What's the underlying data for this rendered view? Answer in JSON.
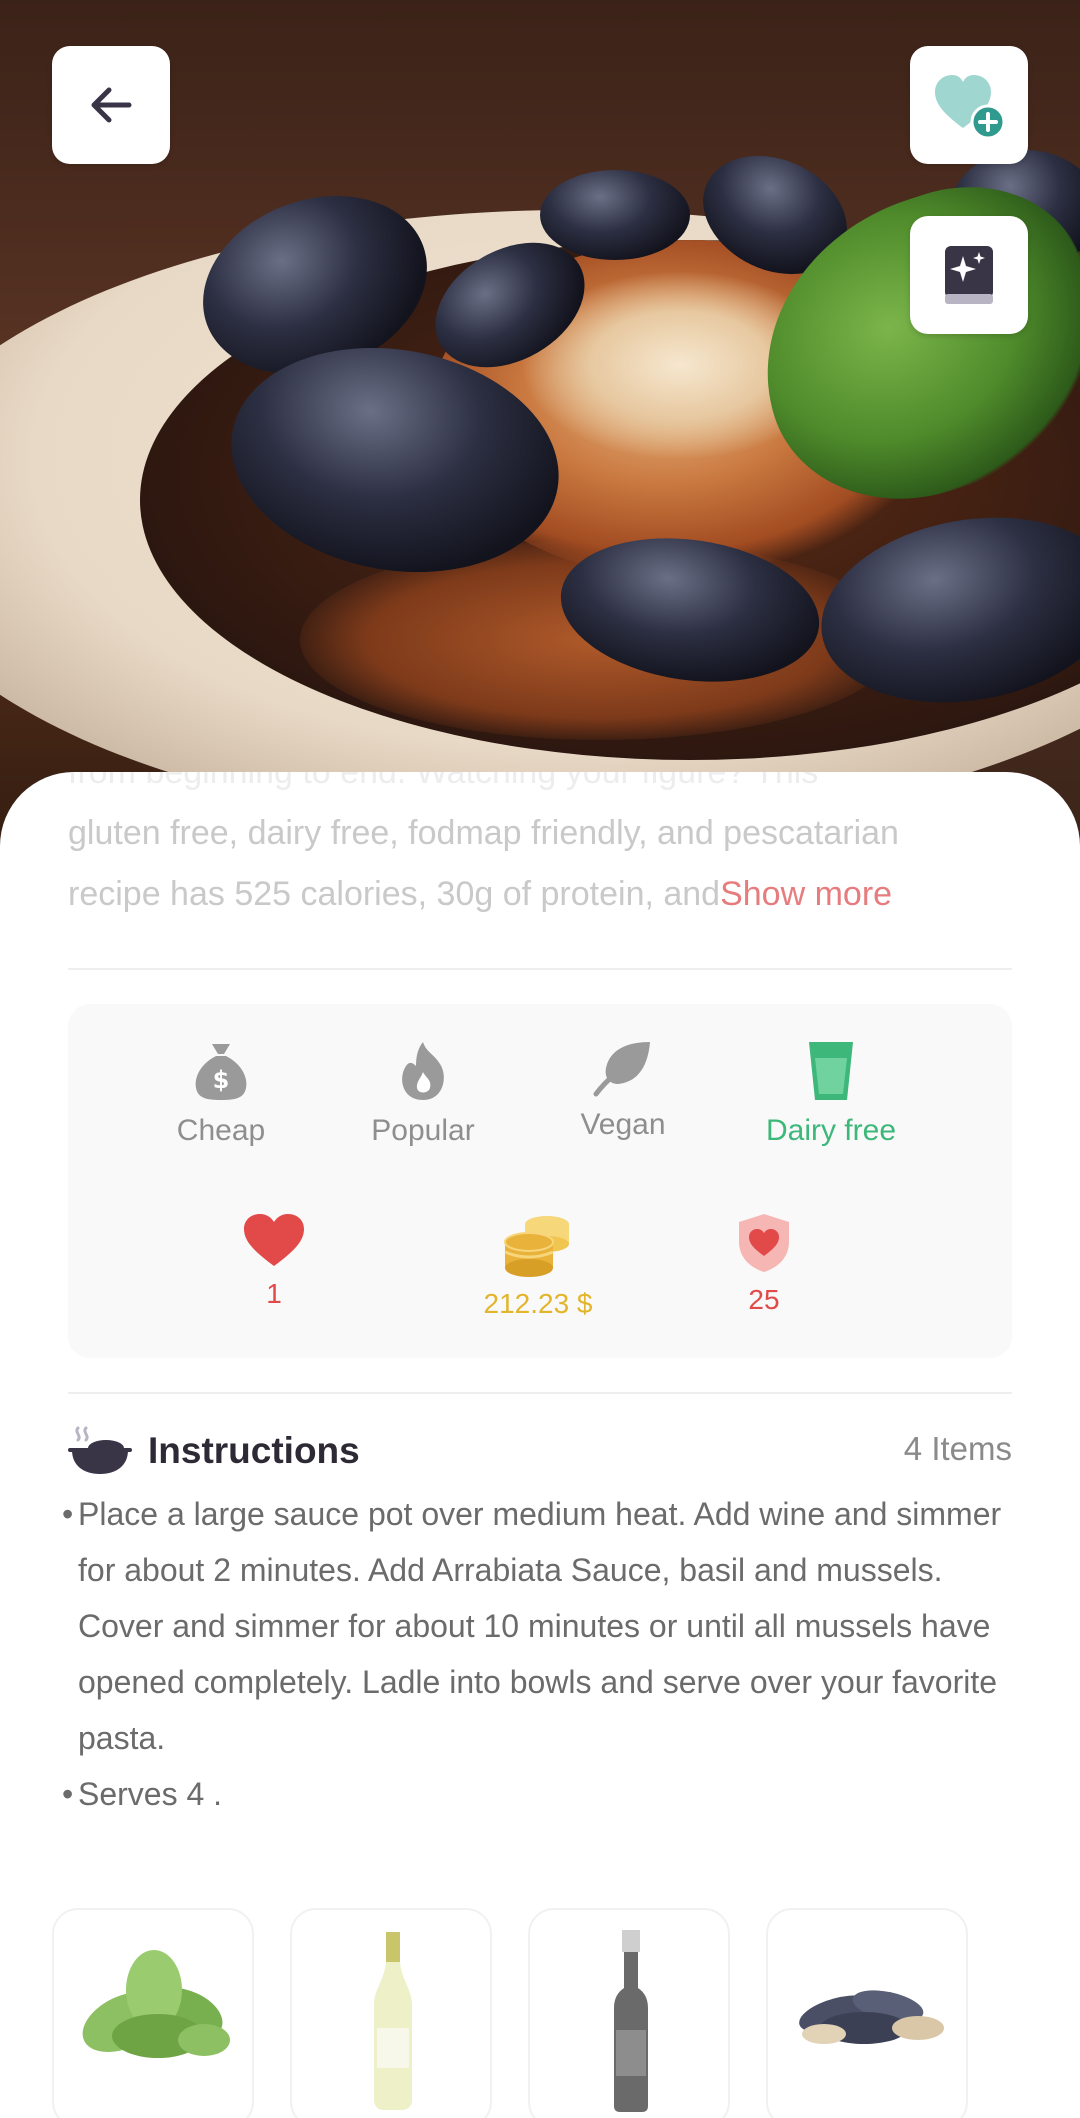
{
  "header": {
    "back_icon": "arrow-left-icon",
    "favorite_icon": "heart-plus-icon",
    "recipe_book_icon": "sparkle-book-icon"
  },
  "summary": {
    "line1": "from beginning to end. Watching your figure? This",
    "line2": "gluten free, dairy free, fodmap friendly, and pescatarian",
    "line3": "recipe has 525 calories, 30g of protein, and",
    "show_more": "Show more"
  },
  "tags": [
    {
      "label": "Cheap",
      "icon": "money-bag-icon",
      "active": false
    },
    {
      "label": "Popular",
      "icon": "flame-icon",
      "active": false
    },
    {
      "label": "Vegan",
      "icon": "leaf-icon",
      "active": false
    },
    {
      "label": "Dairy free",
      "icon": "glass-icon",
      "active": true
    }
  ],
  "stats": {
    "likes": "1",
    "price": "212.23 $",
    "health_score": "25"
  },
  "instructions": {
    "title": "Instructions",
    "count": "4 Items",
    "steps": [
      "Place a large sauce pot over medium heat. Add wine and simmer for about 2 minutes. Add Arrabiata Sauce, basil and mussels. Cover and simmer for about 10 minutes or until all mussels have opened completely. Ladle into bowls and serve over your favorite pasta.",
      "Serves 4 ."
    ],
    "bullet": "•"
  },
  "ingredients": [
    {
      "icon": "basil-image"
    },
    {
      "icon": "white-wine-bottle-image"
    },
    {
      "icon": "dark-bottle-image"
    },
    {
      "icon": "mussels-image"
    }
  ],
  "colors": {
    "accent_red": "#e24a4a",
    "show_more": "#e77c7e",
    "dairy_green": "#3db87a",
    "price_gold": "#e2b52a",
    "title_dark": "#2e2a35"
  }
}
